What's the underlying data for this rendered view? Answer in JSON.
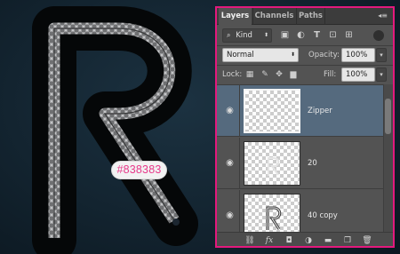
{
  "canvas": {
    "color_tag": "#838383",
    "stroke_color": "#838383"
  },
  "layers_panel": {
    "tabs": [
      {
        "label": "Layers",
        "active": true
      },
      {
        "label": "Channels",
        "active": false
      },
      {
        "label": "Paths",
        "active": false
      }
    ],
    "filter": {
      "label": "Kind",
      "icon": "search-icon"
    },
    "filter_icons": [
      "image-filter-icon",
      "adjustment-filter-icon",
      "type-filter-icon",
      "shape-filter-icon",
      "smart-object-filter-icon"
    ],
    "blend_mode": "Normal",
    "opacity": {
      "label": "Opacity:",
      "value": "100%"
    },
    "lock": {
      "label": "Lock:",
      "icons": [
        "lock-transparent-icon",
        "lock-image-icon",
        "lock-position-icon",
        "lock-all-icon"
      ]
    },
    "fill": {
      "label": "Fill:",
      "value": "100%"
    },
    "layers": [
      {
        "name": "Zipper",
        "selected": true,
        "visible": true
      },
      {
        "name": "20",
        "selected": false,
        "visible": true
      },
      {
        "name": "40 copy",
        "selected": false,
        "visible": true
      }
    ],
    "footer_icons": [
      "link-layers-icon",
      "fx-icon",
      "add-mask-icon",
      "adjustment-layer-icon",
      "new-group-icon",
      "new-layer-icon",
      "delete-layer-icon"
    ]
  },
  "colors": {
    "panel_border": "#e3197d",
    "selected_layer": "#556a7e",
    "tag_text": "#e8398a"
  }
}
